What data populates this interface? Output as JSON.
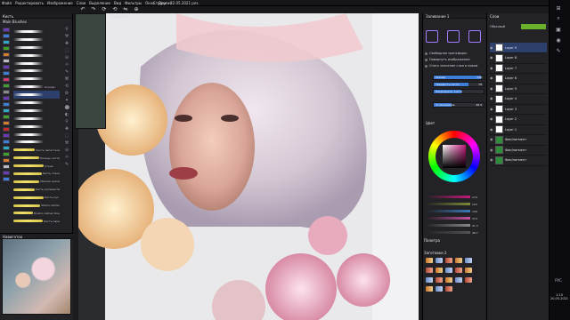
{
  "menu": [
    "Файл",
    "Редактировать",
    "Изображение",
    "Слои",
    "Выделение",
    "Вид",
    "Фильтры",
    "Окно",
    "Другие"
  ],
  "document_tab": "Строки - 22.05.2021 рез.",
  "brushes": {
    "title": "Кисть",
    "set_name": "Main Brushes",
    "items": [
      {
        "name": ""
      },
      {
        "name": ""
      },
      {
        "name": ""
      },
      {
        "name": ""
      },
      {
        "name": ""
      },
      {
        "name": ""
      },
      {
        "name": ""
      },
      {
        "name": "Основа"
      },
      {
        "name": ""
      },
      {
        "name": ""
      },
      {
        "name": ""
      },
      {
        "name": ""
      },
      {
        "name": ""
      },
      {
        "name": ""
      },
      {
        "name": ""
      },
      {
        "name": "Кисть лепестков"
      },
      {
        "name": "Пальцы кисти"
      },
      {
        "name": "Стена"
      },
      {
        "name": "Кисть стена"
      },
      {
        "name": "Мягкая нитка"
      },
      {
        "name": "Кисть-путешеств"
      },
      {
        "name": "Кисть-пух"
      },
      {
        "name": "Stems calmer"
      },
      {
        "name": "Brusho calmer blue"
      },
      {
        "name": "Кисть пера"
      }
    ],
    "selected_index": 8
  },
  "reference": {
    "title": "Референс"
  },
  "navigator": {
    "title": "Навигатор"
  },
  "tool_settings": {
    "title": "Заливание 1",
    "options": [
      "Свободная трансформ.",
      "Повернуть изображение",
      "Снять значение слоя в новом"
    ],
    "sliders": [
      {
        "label": "Размер",
        "value": "126",
        "fill": 0.95
      },
      {
        "label": "Твердость кисти",
        "value": "78",
        "fill": 0.7
      },
      {
        "label": "Непрозрачн. кисти",
        "value": "",
        "fill": 0.55
      },
      {
        "label": "Сглаживание",
        "value": "36.4",
        "fill": 0.35
      }
    ]
  },
  "color": {
    "title": "Цвет",
    "channels": [
      {
        "value": "174",
        "color": "#c21a7c"
      },
      {
        "value": "125",
        "color": "#7d8a3a"
      },
      {
        "value": "130",
        "color": "#3a7ab8"
      },
      {
        "value": "374",
        "color": "#c24fa0"
      },
      {
        "value": "21.3",
        "color": "#888"
      },
      {
        "value": "48.7",
        "color": "#555"
      }
    ]
  },
  "mixer": {
    "title": "Палитра"
  },
  "presets": {
    "title": "Заготовки 2"
  },
  "layers": {
    "title": "Слои",
    "blend_mode": "Обычный",
    "items": [
      {
        "name": "Layer 9"
      },
      {
        "name": "Layer 8"
      },
      {
        "name": "Layer 7"
      },
      {
        "name": "Layer 6"
      },
      {
        "name": "Layer 5"
      },
      {
        "name": "Layer 4"
      },
      {
        "name": "Layer 3"
      },
      {
        "name": "Layer 2"
      },
      {
        "name": "Layer 1"
      },
      {
        "name": "Фон/пигмент"
      },
      {
        "name": "Фон/пигмент"
      },
      {
        "name": "Фон/пигмент"
      }
    ],
    "selected_index": 0
  },
  "taskbar": {
    "lang": "РУС",
    "time": "1:10",
    "date": "20.05.2021"
  }
}
